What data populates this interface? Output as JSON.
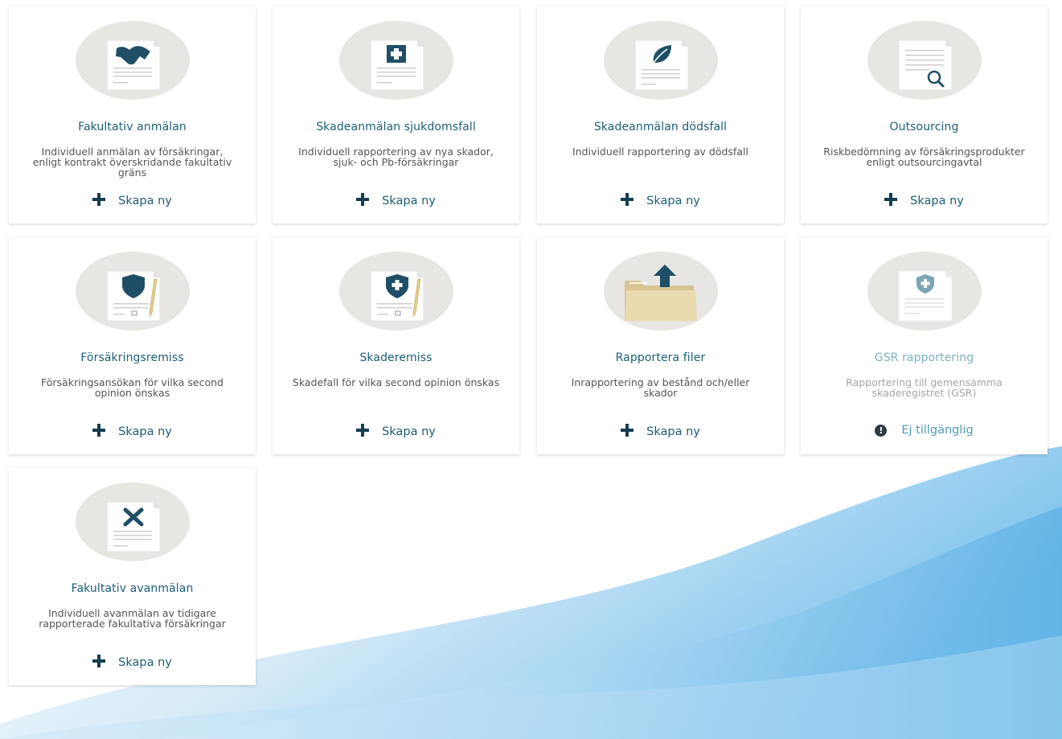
{
  "colors": {
    "title": "#1b5e78",
    "icon_dark": "#163d50",
    "circle": "#e7e6e3",
    "disabled_title": "#7cb0c3"
  },
  "cards": [
    {
      "icon": "handshake-document-icon",
      "title": "Fakultativ anmälan",
      "description": "Individuell anmälan av försäkringar, enligt kontrakt överskridande fakultativ gräns",
      "action": "Skapa ny"
    },
    {
      "icon": "medical-cross-document-icon",
      "title": "Skadeanmälan sjukdomsfall",
      "description": "Individuell rapportering av nya skador, sjuk- och Pb-försäkringar",
      "action": "Skapa ny"
    },
    {
      "icon": "leaf-document-icon",
      "title": "Skadeanmälan dödsfall",
      "description": "Individuell rapportering av dödsfall",
      "action": "Skapa ny"
    },
    {
      "icon": "magnifier-document-icon",
      "title": "Outsourcing",
      "description": "Riskbedömning av försäkringsprodukter enligt outsourcingavtal",
      "action": "Skapa ny"
    },
    {
      "icon": "shield-pencil-document-icon",
      "title": "Försäkringsremiss",
      "description": "Försäkringsansökan för vilka second opinion önskas",
      "action": "Skapa ny"
    },
    {
      "icon": "shield-cross-pencil-document-icon",
      "title": "Skaderemiss",
      "description": "Skadefall för vilka second opinion önskas",
      "action": "Skapa ny"
    },
    {
      "icon": "folder-upload-icon",
      "title": "Rapportera filer",
      "description": "Inrapportering av bestånd och/eller skador",
      "action": "Skapa ny"
    },
    {
      "icon": "shield-cross-document-icon",
      "title": "GSR rapportering",
      "description": "Rapportering till gemensamma skaderegistret (GSR)",
      "action": "Ej tillgänglig",
      "disabled": true
    },
    {
      "icon": "x-document-icon",
      "title": "Fakultativ avanmälan",
      "description": "Individuell avanmälan av tidigare rapporterade fakultativa försäkringar",
      "action": "Skapa ny"
    }
  ]
}
